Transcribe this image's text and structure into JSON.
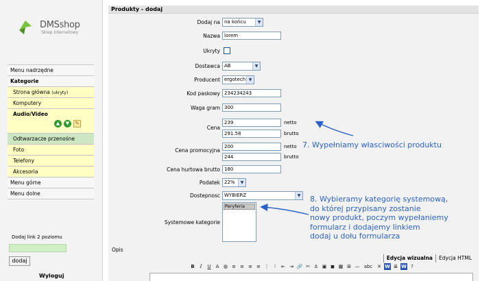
{
  "logo": {
    "name": "DMSshop",
    "tagline": "Sklep internetowy"
  },
  "sidebar": {
    "items": [
      {
        "label": "Menu nadrzędne",
        "style": "plain"
      },
      {
        "label": "Kategorie",
        "style": "bold"
      },
      {
        "label": "Strona główna",
        "note": "(ukryty)",
        "style": "sub"
      },
      {
        "label": "Komputery",
        "style": "sub"
      },
      {
        "label": "Audio/Video",
        "style": "sub-bold"
      },
      {
        "label": "Odtwarzacze przenośne",
        "style": "green"
      },
      {
        "label": "Foto",
        "style": "sub"
      },
      {
        "label": "Telefony",
        "style": "sub"
      },
      {
        "label": "Akcesoria",
        "style": "sub"
      },
      {
        "label": "Menu górne",
        "style": "plain"
      },
      {
        "label": "Menu dolne",
        "style": "plain"
      }
    ],
    "add_level_label": "Dodaj link 2 poziomu",
    "add_level_value": "",
    "add_button": "dodaj",
    "logout": "Wyloguj"
  },
  "panel": {
    "title": "Produkty - dodaj",
    "dodaj_na": {
      "label": "Dodaj na",
      "value": "na końcu"
    },
    "nazwa": {
      "label": "Nazwa",
      "value": "lorem"
    },
    "ukryty": {
      "label": "Ukryty",
      "checked": false
    },
    "dostawca": {
      "label": "Dostawca",
      "value": "AB"
    },
    "producent": {
      "label": "Producent",
      "value": "ergotech"
    },
    "kod": {
      "label": "Kod paskowy",
      "value": "234234243"
    },
    "waga": {
      "label": "Waga gram",
      "value": "300"
    },
    "cena": {
      "label": "Cena",
      "netto": "239",
      "brutto": "291.58",
      "netto_label": "netto",
      "brutto_label": "brutto"
    },
    "cena_promo": {
      "label": "Cena promocyjna",
      "netto": "200",
      "brutto": "244",
      "netto_label": "netto",
      "brutto_label": "brutto"
    },
    "cena_hurt": {
      "label": "Cena hurtowa brutto",
      "value": "180"
    },
    "podatek": {
      "label": "Podatek",
      "value": "22%"
    },
    "dostepnosc": {
      "label": "Dostepnosc",
      "value": "WYBIERZ"
    },
    "kategorie": {
      "label": "Systemowe kategorie",
      "options": [
        "Peryferia"
      ]
    },
    "opis": {
      "label": "Opis",
      "tabs": [
        "Edycja wizualna",
        "Edycja HTML"
      ]
    },
    "toolbar": [
      {
        "name": "bold-icon",
        "glyph": "B"
      },
      {
        "name": "italic-icon",
        "glyph": "I"
      },
      {
        "name": "underline-icon",
        "glyph": "U"
      },
      {
        "name": "font-color-icon",
        "glyph": "A"
      },
      {
        "name": "palette-icon",
        "glyph": "◍"
      },
      {
        "name": "align-left-icon",
        "glyph": "≡"
      },
      {
        "name": "align-center-icon",
        "glyph": "≡"
      },
      {
        "name": "align-right-icon",
        "glyph": "≡"
      },
      {
        "name": "justify-icon",
        "glyph": "≡"
      },
      {
        "name": "numbered-list-icon",
        "glyph": "⋮"
      },
      {
        "name": "bullet-list-icon",
        "glyph": "⁝"
      },
      {
        "name": "outdent-icon",
        "glyph": "⇤"
      },
      {
        "name": "indent-icon",
        "glyph": "⇥"
      },
      {
        "name": "link-icon",
        "glyph": "🔗"
      },
      {
        "name": "unlink-icon",
        "glyph": "✂"
      },
      {
        "name": "anchor-icon",
        "glyph": "⚓"
      },
      {
        "name": "image-icon",
        "glyph": "▣"
      },
      {
        "name": "media-icon",
        "glyph": "◼"
      },
      {
        "name": "table-icon",
        "glyph": "▦"
      },
      {
        "name": "grid-icon",
        "glyph": "⊞"
      },
      {
        "name": "horizontal-rule-icon",
        "glyph": "—"
      },
      {
        "name": "strikethrough-icon",
        "glyph": "abc"
      },
      {
        "name": "remove-format-icon",
        "glyph": "✕"
      },
      {
        "name": "paste-word-icon",
        "glyph": "W"
      },
      {
        "name": "html-source-icon",
        "glyph": "≣"
      },
      {
        "name": "paste-word-2-icon",
        "glyph": "W"
      },
      {
        "name": "help-icon",
        "glyph": "?"
      }
    ]
  },
  "annotations": {
    "step7": "7. Wypełniamy własciwości produktu",
    "step8": [
      "8. Wybieramy kategorię systemową,",
      "do której przypisany zostanie",
      "nowy produkt, poczym wypełaniemy",
      "formularz i  dodajemy linkiem",
      "dodaj u dołu formularza"
    ]
  },
  "colors": {
    "sidebar_sub_bg": "#ffffc4",
    "sidebar_selected_bg": "#cce7c2",
    "annotation": "#2a62c7",
    "field_border": "#7f9db9"
  }
}
